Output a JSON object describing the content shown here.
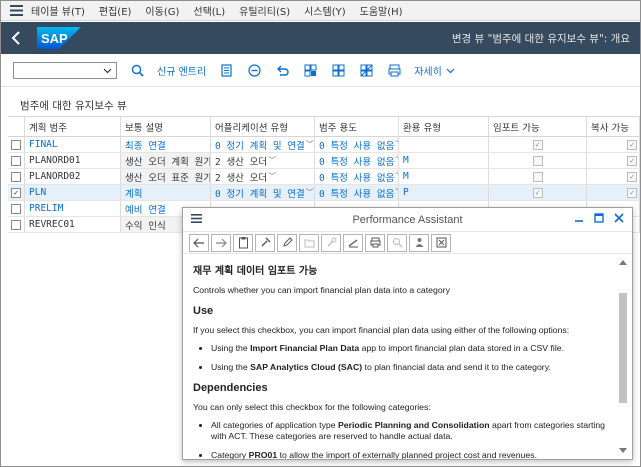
{
  "menubar": {
    "items": [
      "테이블 뷰(T)",
      "편집(E)",
      "이동(G)",
      "선택(L)",
      "유틸리티(S)",
      "시스템(Y)",
      "도움말(H)"
    ]
  },
  "header": {
    "logo_text": "SAP",
    "title": "변경 뷰 \"범주에 대한 유지보수 뷰\": 개요",
    "bg_color": "#354a5f"
  },
  "toolbar": {
    "dropdown_value": "",
    "new_entries_label": "신규 엔트리",
    "details_label": "자세히"
  },
  "section_title": "범주에 대한 유지보수 뷰",
  "table": {
    "headers": [
      "계획 범주",
      "보통 설명",
      "어플리케이션 유형",
      "범주 용도",
      "환용 유형",
      "임포트 가능",
      "복사 가능"
    ],
    "rows": [
      {
        "category": "FINAL",
        "desc": "최종 연결",
        "app_type": "0 정기 계획 및 연결",
        "usage": "0 특정 사용 없음",
        "currency": "",
        "import": true,
        "copy": true,
        "selected": false,
        "cat_blue": true,
        "desc_blue": true
      },
      {
        "category": "PLANORD01",
        "desc": "생산 오더 계획 원가",
        "app_type": "2 생산 오더",
        "usage": "0 특정 사용 없음",
        "currency": "M",
        "import": false,
        "copy": true,
        "selected": false,
        "cat_blue": false,
        "desc_blue": false
      },
      {
        "category": "PLANORD02",
        "desc": "생산 오더 표준 원가",
        "app_type": "2 생산 오더",
        "usage": "0 특정 사용 없음",
        "currency": "M",
        "import": false,
        "copy": true,
        "selected": false,
        "cat_blue": false,
        "desc_blue": false
      },
      {
        "category": "PLN",
        "desc": "계획",
        "app_type": "0 정기 계획 및 연결",
        "usage": "0 특정 사용 없음",
        "currency": "P",
        "import": true,
        "copy": true,
        "selected": true,
        "cat_blue": true,
        "desc_blue": true
      },
      {
        "category": "PRELIM",
        "desc": "예비 연결",
        "app_type": "",
        "usage": "",
        "currency": "",
        "import": false,
        "copy": false,
        "selected": false,
        "cat_blue": true,
        "desc_blue": true
      },
      {
        "category": "REVREC01",
        "desc": "수익 인식",
        "app_type": "",
        "usage": "",
        "currency": "",
        "import": false,
        "copy": false,
        "selected": false,
        "cat_blue": false,
        "desc_blue": false
      }
    ]
  },
  "assistant": {
    "title": "Performance Assistant",
    "heading": "재무 계획 데이터 임포트 가능",
    "intro": "Controls whether you can import financial plan data into a category",
    "use_heading": "Use",
    "use_text": "If you select this checkbox, you can import financial plan data using either of the following options:",
    "bullet1_pre": "Using the ",
    "bullet1_bold": "Import Financial Plan Data",
    "bullet1_post": " app to import financial plan data stored in a CSV file.",
    "bullet2_pre": "Using the ",
    "bullet2_bold": "SAP Analytics Cloud (SAC)",
    "bullet2_post": " to plan financial data and send it to the category.",
    "dep_heading": "Dependencies",
    "dep_text": "You can only select this checkbox for the following categories:",
    "dep1_pre": "All categories of application type ",
    "dep1_bold": "Periodic Planning and Consolidation",
    "dep1_post": " apart from categories starting with ACT. These categories are reserved to handle actual data.",
    "dep2_pre": "Category ",
    "dep2_bold": "PRO01",
    "dep2_post": " to allow the import of externally planned project cost and revenues."
  },
  "colors": {
    "link_blue": "#0a6ed1",
    "selected_row": "#e5f0fa"
  }
}
